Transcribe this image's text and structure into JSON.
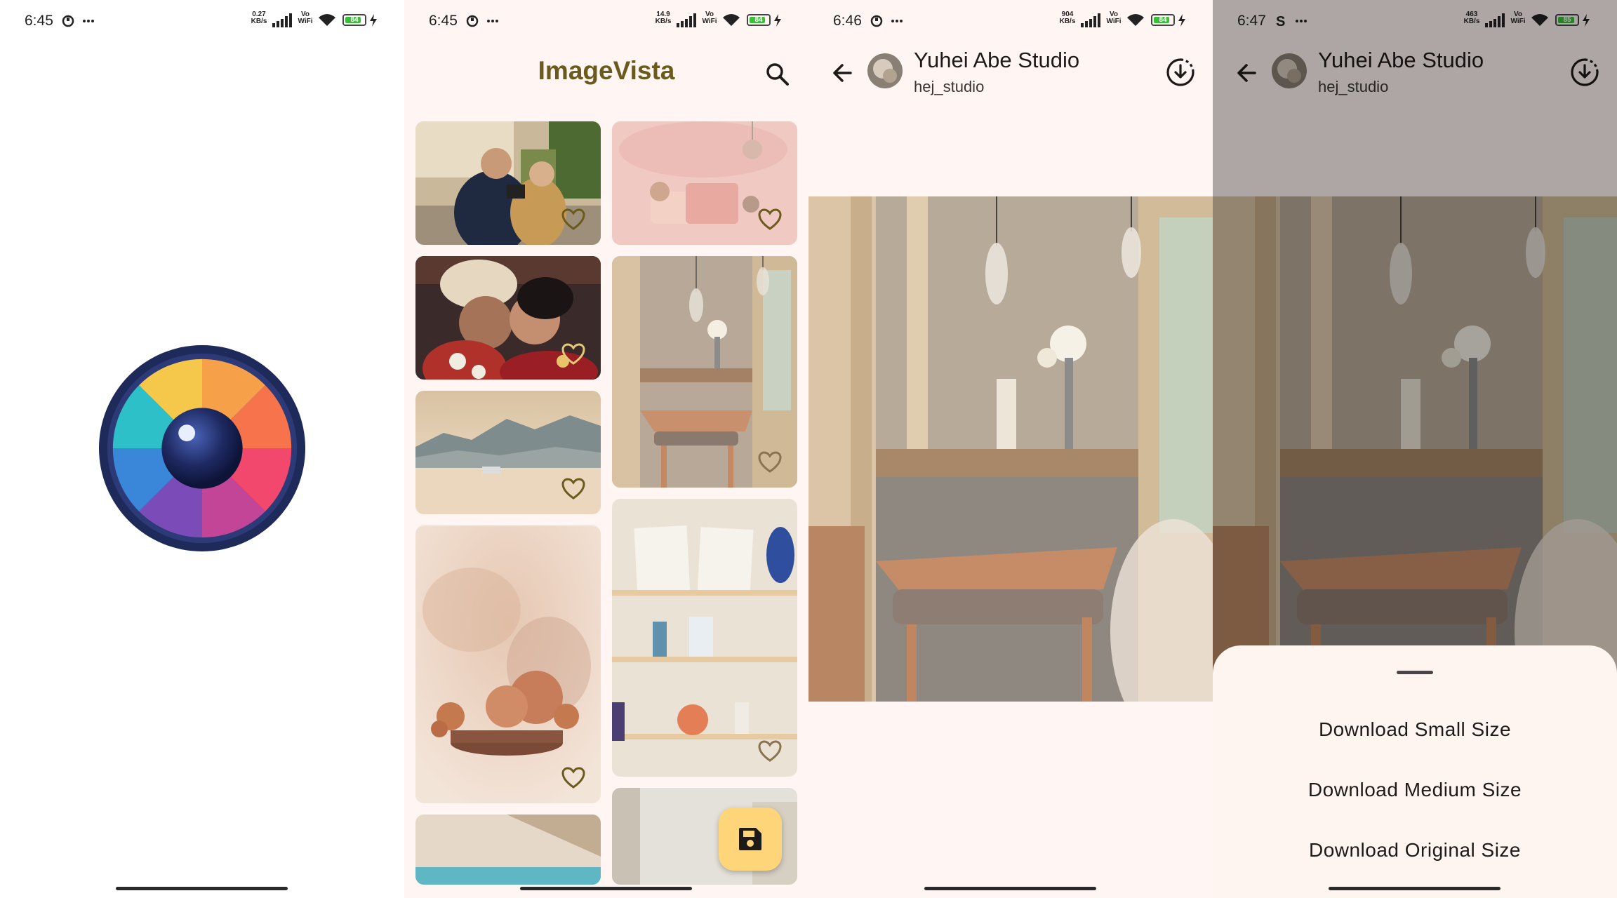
{
  "colors": {
    "accent": "#6b5a1e",
    "fab": "#ffd57a",
    "surface": "#fff5f2",
    "battery": "#3bbf3a"
  },
  "panels": [
    {
      "status": {
        "time": "6:45",
        "speed_top": "0.27",
        "speed_bottom": "KB/s",
        "battery": "84"
      }
    },
    {
      "status": {
        "time": "6:45",
        "speed_top": "14.9",
        "speed_bottom": "KB/s",
        "battery": "84"
      }
    },
    {
      "status": {
        "time": "6:46",
        "speed_top": "904",
        "speed_bottom": "KB/s",
        "battery": "84"
      }
    },
    {
      "status": {
        "time": "6:47",
        "speed_top": "463",
        "speed_bottom": "KB/s",
        "battery": "85"
      }
    }
  ],
  "status_common": {
    "vo": "Vo",
    "wifi": "WiFi"
  },
  "home": {
    "app_title": "ImageVista",
    "search_icon": "search-icon",
    "fab_icon": "save-icon"
  },
  "detail": {
    "author_name": "Yuhei Abe Studio",
    "username": "hej_studio",
    "download_icon": "download-icon"
  },
  "sheet": {
    "options": [
      "Download Small Size",
      "Download Medium Size",
      "Download Original Size"
    ]
  }
}
